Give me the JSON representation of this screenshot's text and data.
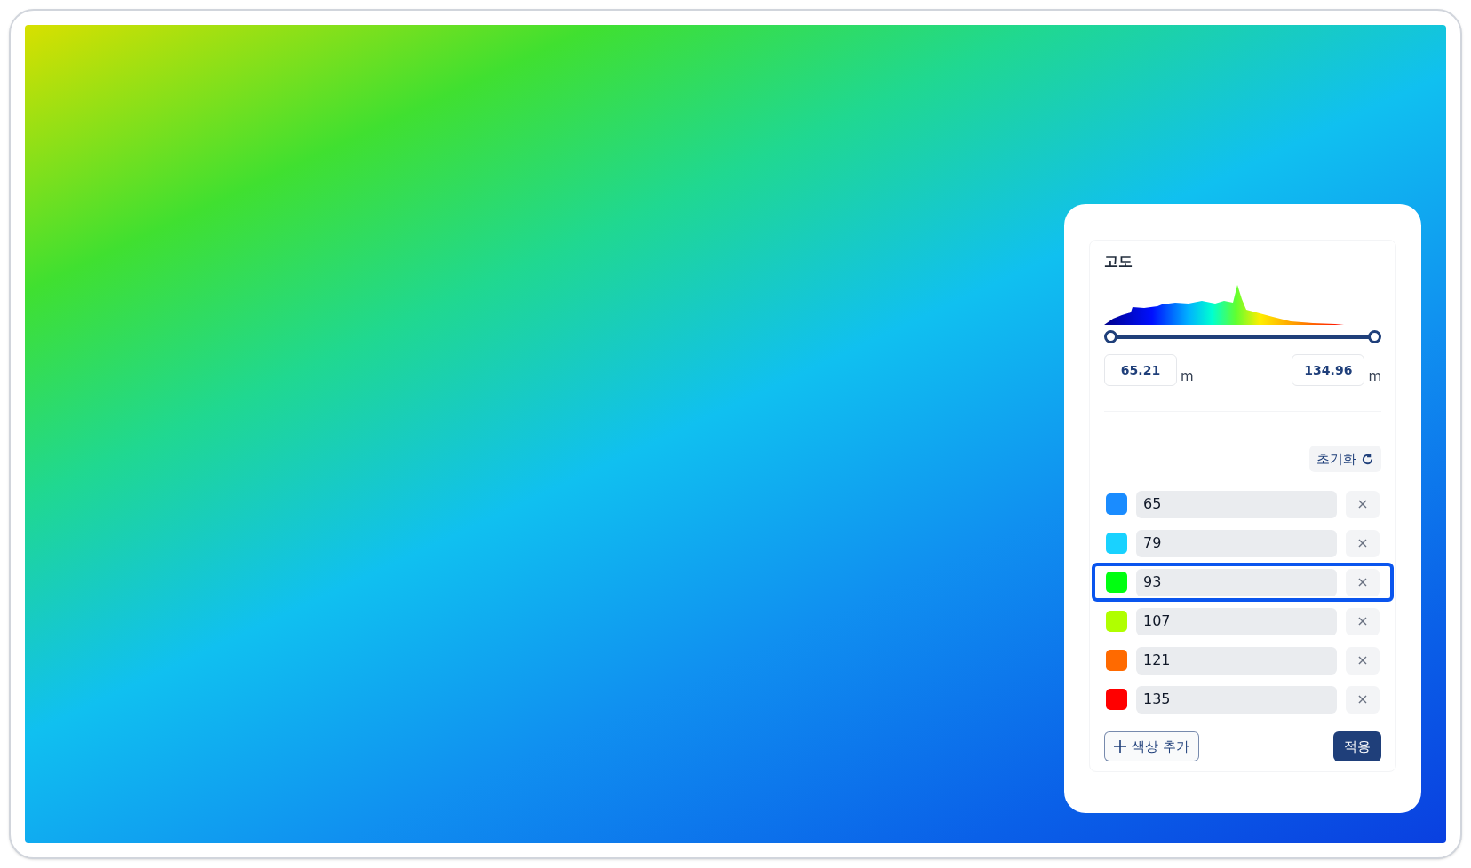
{
  "panel": {
    "title": "고도",
    "range": {
      "level": 1,
      "min": "65.21",
      "max": "134.96",
      "min_unit": "m",
      "max_unit": "m"
    },
    "reset_button": "초기화",
    "stops": [
      {
        "color": "#1a8cff",
        "value": "65",
        "remove": "×",
        "selected": false
      },
      {
        "color": "#19d2ff",
        "value": "79",
        "remove": "×",
        "selected": false
      },
      {
        "color": "#00ff10",
        "value": "93",
        "remove": "×",
        "selected": true
      },
      {
        "color": "#b0ff00",
        "value": "107",
        "remove": "×",
        "selected": false
      },
      {
        "color": "#ff6a00",
        "value": "121",
        "remove": "×",
        "selected": false
      },
      {
        "color": "#ff0000",
        "value": "135",
        "remove": "×",
        "selected": false
      }
    ],
    "add_button": "색상 추가",
    "apply_button": "적용"
  }
}
